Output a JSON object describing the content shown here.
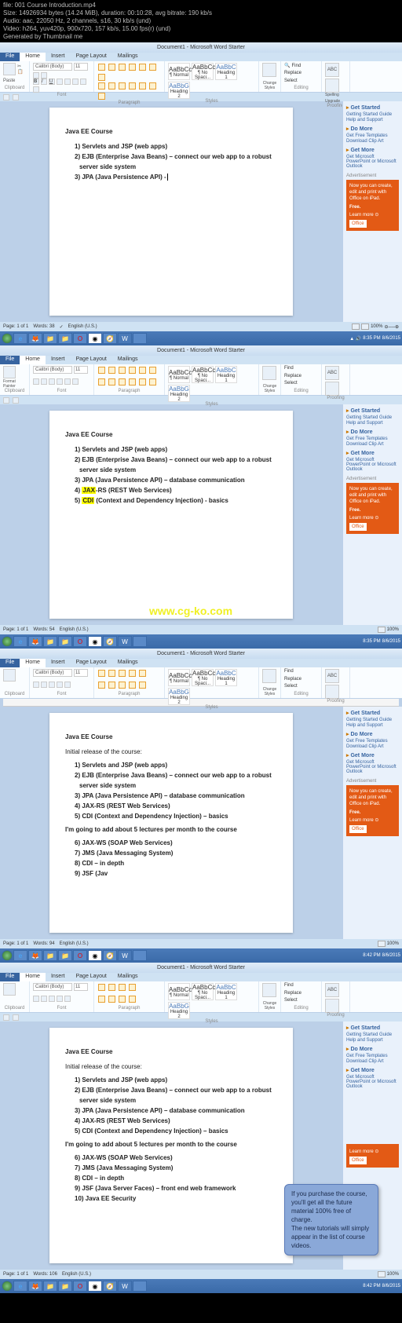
{
  "video_info": [
    "file: 001 Course Introduction.mp4",
    "Size: 14926934 bytes (14.24 MiB), duration: 00:10:28, avg bitrate: 190 kb/s",
    "Audio: aac, 22050 Hz, 2 channels, s16, 30 kb/s (und)",
    "Video: h264, yuv420p, 900x720, 157 kb/s, 15.00 fps(r) (und)",
    "Generated by Thumbnail me"
  ],
  "titlebar": "Document1 - Microsoft Word Starter",
  "tabs": {
    "file": "File",
    "home": "Home",
    "insert": "Insert",
    "pagelayout": "Page Layout",
    "mailings": "Mailings"
  },
  "ribbon": {
    "font_name": "Calibri (Body)",
    "font_size": "11",
    "groups": {
      "clipboard": "Clipboard",
      "font": "Font",
      "paragraph": "Paragraph",
      "styles": "Styles",
      "editing": "Editing",
      "proofing": "Proofing"
    },
    "paste": "Paste",
    "formatpainter": "Format Painter",
    "styles": [
      {
        "sample": "AaBbCcDc",
        "name": "¶ Normal"
      },
      {
        "sample": "AaBbCcDc",
        "name": "¶ No Spaci..."
      },
      {
        "sample": "AaBbC",
        "name": "Heading 1"
      },
      {
        "sample": "AaBbG",
        "name": "Heading 2"
      }
    ],
    "change": "Change Styles",
    "find": "Find",
    "replace": "Replace",
    "select": "Select",
    "spelling": "Spelling",
    "upgrade": "Upgrade"
  },
  "sidebar": {
    "get_started": "Get Started",
    "gs_guide": "Getting Started Guide",
    "help": "Help and Support",
    "do_more": "Do More",
    "templates": "Get Free Templates",
    "clipart": "Download Clip Art",
    "get_more": "Get More",
    "ppt": "Get Microsoft PowerPoint or Microsoft Outlook",
    "ad_label": "Advertisement",
    "ad_text": "Now you can create, edit and print with Office on iPad.",
    "free": "Free.",
    "learn": "Learn more ⊙",
    "office": "Office"
  },
  "statusbar": {
    "page": "Page: 1 of 1",
    "words_38": "Words: 38",
    "words_54": "Words: 54",
    "words_94": "Words: 94",
    "words_106": "Words: 106",
    "lang": "English (U.S.)",
    "zoom": "100%"
  },
  "taskbar": {
    "time1": "8:35 PM",
    "date1": "8/6/2015",
    "time3": "8:42 PM"
  },
  "watermark": "www.cg-ko.com",
  "doc1": {
    "title": "Java EE Course",
    "l1": "1) Servlets and JSP (web apps)",
    "l2": "2) EJB (Enterprise Java Beans) – connect our web app to a robust",
    "l2b": "server side system",
    "l3": "3) JPA (Java Persistence API) - "
  },
  "doc2": {
    "title": "Java EE Course",
    "l1": "1) Servlets and JSP (web apps)",
    "l2": "2) EJB (Enterprise Java Beans) – connect our web app to a robust",
    "l2b": "server side system",
    "l3": "3) JPA (Java Persistence API) – database communication",
    "l4a": "4) ",
    "l4h": "JAX",
    "l4b": "-RS (REST Web Services)",
    "l5a": "5) ",
    "l5h": "CDI",
    "l5b": " (Context and Dependency Injection) - basics"
  },
  "doc3": {
    "title": "Java EE Course",
    "sub": "Initial release of the course:",
    "l1": "1) Servlets and JSP (web apps)",
    "l2": "2) EJB (Enterprise Java Beans) – connect our web app to a robust",
    "l2b": "server side system",
    "l3": "3) JPA (Java Persistence API) – database communication",
    "l4": "4) JAX-RS (REST Web Services)",
    "l5": "5) CDI (Context and Dependency Injection) – basics",
    "add": "I'm going to add about 5 lectures per month to the course",
    "l6": "6) JAX-WS (SOAP Web Services)",
    "l7": "7) JMS (Java Messaging System)",
    "l8": "8) CDI – in depth",
    "l9": "9) JSF (Jav"
  },
  "doc4": {
    "title": "Java EE Course",
    "sub": "Initial release of the course:",
    "l1": "1) Servlets and JSP (web apps)",
    "l2": "2) EJB (Enterprise Java Beans) – connect our web app to a robust",
    "l2b": "server side system",
    "l3": "3) JPA (Java Persistence API) – database communication",
    "l4": "4) JAX-RS (REST Web Services)",
    "l5": "5) CDI (Context and Dependency Injection) – basics",
    "add": "I'm going to add about 5 lectures per month to the course",
    "l6": "6) JAX-WS (SOAP Web Services)",
    "l7": "7) JMS (Java Messaging System)",
    "l8": "8) CDI – in depth",
    "l9": "9) JSF (Java Server Faces) – front end web framework",
    "l10": "10) Java EE Security"
  },
  "callout": "If you purchase the course, you'll get all the future material 100% free of charge.\nThe new tutorials will simply appear in the list of course videos."
}
